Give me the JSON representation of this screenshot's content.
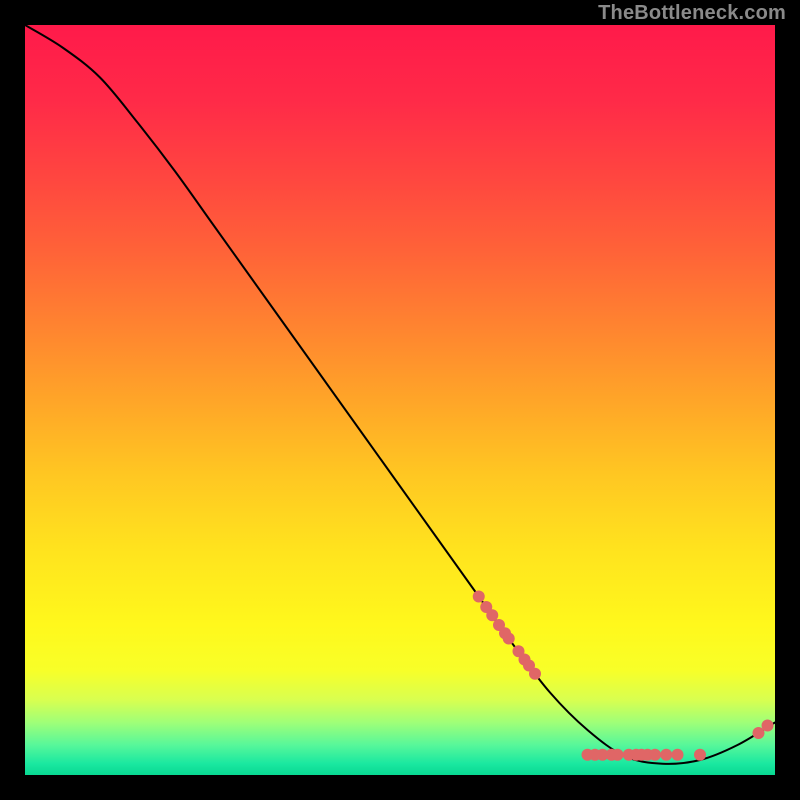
{
  "attribution": "TheBottleneck.com",
  "chart_data": {
    "type": "line",
    "title": "",
    "xlabel": "",
    "ylabel": "",
    "xlim": [
      0,
      100
    ],
    "ylim": [
      0,
      100
    ],
    "curve": [
      {
        "x": 0,
        "y": 100
      },
      {
        "x": 5,
        "y": 97
      },
      {
        "x": 10,
        "y": 93
      },
      {
        "x": 15,
        "y": 87
      },
      {
        "x": 20,
        "y": 80.5
      },
      {
        "x": 25,
        "y": 73.5
      },
      {
        "x": 30,
        "y": 66.5
      },
      {
        "x": 35,
        "y": 59.5
      },
      {
        "x": 40,
        "y": 52.5
      },
      {
        "x": 45,
        "y": 45.5
      },
      {
        "x": 50,
        "y": 38.5
      },
      {
        "x": 55,
        "y": 31.5
      },
      {
        "x": 60,
        "y": 24.5
      },
      {
        "x": 65,
        "y": 17.5
      },
      {
        "x": 70,
        "y": 11
      },
      {
        "x": 75,
        "y": 6
      },
      {
        "x": 80,
        "y": 2.5
      },
      {
        "x": 85,
        "y": 1.5
      },
      {
        "x": 90,
        "y": 2
      },
      {
        "x": 95,
        "y": 4
      },
      {
        "x": 100,
        "y": 7
      }
    ],
    "points": [
      {
        "x": 60.5,
        "y": 23.8
      },
      {
        "x": 61.5,
        "y": 22.4
      },
      {
        "x": 62.3,
        "y": 21.3
      },
      {
        "x": 63.2,
        "y": 20.0
      },
      {
        "x": 64.0,
        "y": 18.9
      },
      {
        "x": 64.5,
        "y": 18.2
      },
      {
        "x": 65.8,
        "y": 16.5
      },
      {
        "x": 66.6,
        "y": 15.4
      },
      {
        "x": 67.2,
        "y": 14.6
      },
      {
        "x": 68.0,
        "y": 13.5
      },
      {
        "x": 75.0,
        "y": 2.7
      },
      {
        "x": 76.0,
        "y": 2.7
      },
      {
        "x": 77.0,
        "y": 2.7
      },
      {
        "x": 78.2,
        "y": 2.7
      },
      {
        "x": 79.0,
        "y": 2.7
      },
      {
        "x": 80.5,
        "y": 2.7
      },
      {
        "x": 81.5,
        "y": 2.7
      },
      {
        "x": 82.2,
        "y": 2.7
      },
      {
        "x": 83.0,
        "y": 2.7
      },
      {
        "x": 84.0,
        "y": 2.7
      },
      {
        "x": 85.5,
        "y": 2.7
      },
      {
        "x": 87.0,
        "y": 2.7
      },
      {
        "x": 90.0,
        "y": 2.7
      },
      {
        "x": 97.8,
        "y": 5.6
      },
      {
        "x": 99.0,
        "y": 6.6
      }
    ],
    "point_color": "#e06666",
    "point_radius_frac": 0.008,
    "line_color": "#000000",
    "line_width": 2,
    "gradient_stops": [
      {
        "offset": 0.0,
        "color": "#ff1a4a"
      },
      {
        "offset": 0.1,
        "color": "#ff2a48"
      },
      {
        "offset": 0.2,
        "color": "#ff4540"
      },
      {
        "offset": 0.3,
        "color": "#ff6238"
      },
      {
        "offset": 0.4,
        "color": "#ff8330"
      },
      {
        "offset": 0.5,
        "color": "#ffa528"
      },
      {
        "offset": 0.6,
        "color": "#ffc722"
      },
      {
        "offset": 0.7,
        "color": "#ffe31e"
      },
      {
        "offset": 0.8,
        "color": "#fff81c"
      },
      {
        "offset": 0.86,
        "color": "#f8ff28"
      },
      {
        "offset": 0.9,
        "color": "#d8ff50"
      },
      {
        "offset": 0.93,
        "color": "#9fff78"
      },
      {
        "offset": 0.96,
        "color": "#57f79a"
      },
      {
        "offset": 0.985,
        "color": "#1ae8a0"
      },
      {
        "offset": 1.0,
        "color": "#08d892"
      }
    ]
  }
}
